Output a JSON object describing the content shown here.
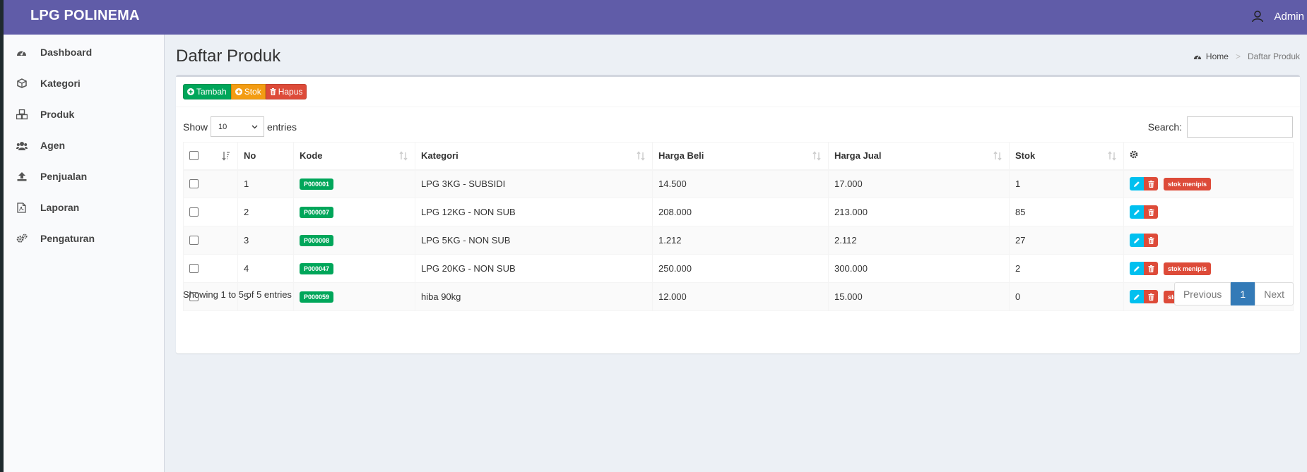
{
  "app": {
    "brand": "LPG POLINEMA",
    "user": "Admin"
  },
  "sidebar": {
    "items": [
      {
        "label": "Dashboard",
        "icon": "dashboard-icon"
      },
      {
        "label": "Kategori",
        "icon": "cube-icon"
      },
      {
        "label": "Produk",
        "icon": "cubes-icon"
      },
      {
        "label": "Agen",
        "icon": "users-icon"
      },
      {
        "label": "Penjualan",
        "icon": "upload-icon"
      },
      {
        "label": "Laporan",
        "icon": "file-pdf-icon"
      },
      {
        "label": "Pengaturan",
        "icon": "cogs-icon"
      }
    ]
  },
  "page": {
    "title": "Daftar Produk"
  },
  "breadcrumb": {
    "home": "Home",
    "current": "Daftar Produk"
  },
  "toolbar": {
    "add": "Tambah",
    "stock": "Stok",
    "delete": "Hapus"
  },
  "table_controls": {
    "show": "Show",
    "page_size": "10",
    "entries": "entries",
    "search_label": "Search:",
    "search_value": ""
  },
  "table": {
    "headers": {
      "no": "No",
      "kode": "Kode",
      "kategori": "Kategori",
      "harga_beli": "Harga Beli",
      "harga_jual": "Harga Jual",
      "stok": "Stok"
    },
    "rows": [
      {
        "no": "1",
        "kode": "P000001",
        "kategori": "LPG 3KG - SUBSIDI",
        "harga_beli": "14.500",
        "harga_jual": "17.000",
        "stok": "1",
        "status": "stok menipis"
      },
      {
        "no": "2",
        "kode": "P000007",
        "kategori": "LPG 12KG - NON SUB",
        "harga_beli": "208.000",
        "harga_jual": "213.000",
        "stok": "85",
        "status": ""
      },
      {
        "no": "3",
        "kode": "P000008",
        "kategori": "LPG 5KG - NON SUB",
        "harga_beli": "1.212",
        "harga_jual": "2.112",
        "stok": "27",
        "status": ""
      },
      {
        "no": "4",
        "kode": "P000047",
        "kategori": "LPG 20KG - NON SUB",
        "harga_beli": "250.000",
        "harga_jual": "300.000",
        "stok": "2",
        "status": "stok menipis"
      },
      {
        "no": "5",
        "kode": "P000059",
        "kategori": "hiba 90kg",
        "harga_beli": "12.000",
        "harga_jual": "15.000",
        "stok": "0",
        "status": "stok kosong"
      }
    ]
  },
  "footer": {
    "info": "Showing 1 to 5 of 5 entries",
    "previous": "Previous",
    "current_page": "1",
    "next": "Next"
  },
  "colors": {
    "header": "#605ca8",
    "success": "#00a65a",
    "warning": "#f39c12",
    "danger": "#dd4b39",
    "info": "#00c0ef",
    "primary": "#337ab7"
  }
}
